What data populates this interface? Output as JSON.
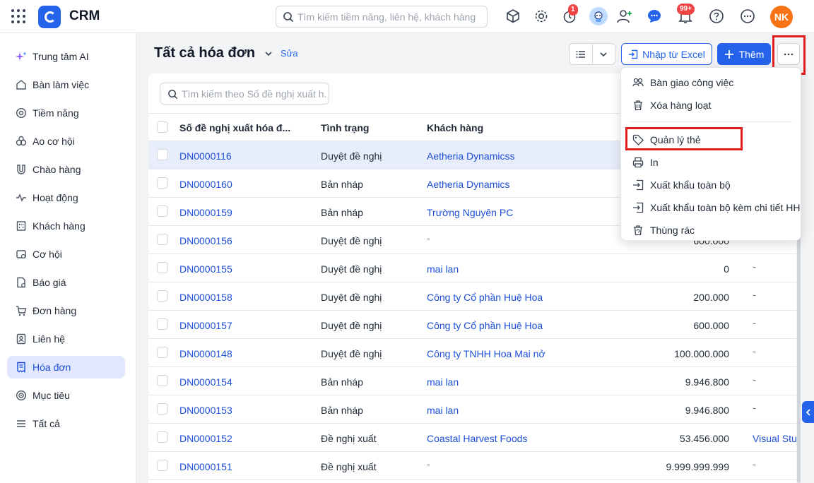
{
  "app": {
    "title": "CRM",
    "avatar_initials": "NK"
  },
  "header": {
    "search_placeholder": "Tìm kiếm tiềm năng, liên hệ, khách hàng",
    "timer_badge": "1",
    "notification_badge": "99+"
  },
  "sidebar": {
    "items": [
      {
        "label": "Trung tâm AI",
        "icon": "sparkle-icon"
      },
      {
        "label": "Bàn làm việc",
        "icon": "home-icon"
      },
      {
        "label": "Tiềm năng",
        "icon": "target-icon"
      },
      {
        "label": "Ao cơ hội",
        "icon": "people-icon"
      },
      {
        "label": "Chào hàng",
        "icon": "magnet-icon"
      },
      {
        "label": "Hoạt động",
        "icon": "activity-icon"
      },
      {
        "label": "Khách hàng",
        "icon": "building-icon"
      },
      {
        "label": "Cơ hội",
        "icon": "opportunity-icon"
      },
      {
        "label": "Báo giá",
        "icon": "quote-icon"
      },
      {
        "label": "Đơn hàng",
        "icon": "cart-icon"
      },
      {
        "label": "Liên hệ",
        "icon": "contact-icon"
      },
      {
        "label": "Hóa đơn",
        "icon": "invoice-icon",
        "active": true
      },
      {
        "label": "Mục tiêu",
        "icon": "goal-icon"
      },
      {
        "label": "Tất cả",
        "icon": "menu-icon"
      }
    ]
  },
  "page": {
    "title": "Tất cả hóa đơn",
    "edit_label": "Sửa",
    "import_label": "Nhập từ Excel",
    "add_label": "Thêm"
  },
  "table": {
    "search_placeholder": "Tìm kiếm theo Số đề nghị xuất h...",
    "columns": [
      "Số đề nghị xuất hóa đ...",
      "Tình trạng",
      "Khách hàng"
    ],
    "rows": [
      {
        "code": "DN0000116",
        "status": "Duyệt đề nghị",
        "customer": "Aetheria Dynamicss",
        "amount": "",
        "extra": ""
      },
      {
        "code": "DN0000160",
        "status": "Bản nháp",
        "customer": "Aetheria Dynamics",
        "amount": "",
        "extra": ""
      },
      {
        "code": "DN0000159",
        "status": "Bản nháp",
        "customer": "Trường Nguyên PC",
        "amount": "",
        "extra": ""
      },
      {
        "code": "DN0000156",
        "status": "Duyệt đề nghị",
        "customer": "-",
        "amount": "600.000",
        "extra": ""
      },
      {
        "code": "DN0000155",
        "status": "Duyệt đề nghị",
        "customer": "mai lan",
        "amount": "0",
        "extra": "-"
      },
      {
        "code": "DN0000158",
        "status": "Duyệt đề nghị",
        "customer": "Công ty Cổ phần Huệ Hoa",
        "amount": "200.000",
        "extra": "-"
      },
      {
        "code": "DN0000157",
        "status": "Duyệt đề nghị",
        "customer": "Công ty Cổ phần Huệ Hoa",
        "amount": "600.000",
        "extra": "-"
      },
      {
        "code": "DN0000148",
        "status": "Duyệt đề nghị",
        "customer": "Công ty TNHH Hoa Mai nở",
        "amount": "100.000.000",
        "extra": "-"
      },
      {
        "code": "DN0000154",
        "status": "Bản nháp",
        "customer": "mai lan",
        "amount": "9.946.800",
        "extra": "-"
      },
      {
        "code": "DN0000153",
        "status": "Bản nháp",
        "customer": "mai lan",
        "amount": "9.946.800",
        "extra": "-"
      },
      {
        "code": "DN0000152",
        "status": "Đề nghị xuất",
        "customer": "Coastal Harvest Foods",
        "amount": "53.456.000",
        "extra": "Visual Stu"
      },
      {
        "code": "DN0000151",
        "status": "Đề nghị xuất",
        "customer": "-",
        "amount": "9.999.999.999",
        "extra": "-"
      }
    ]
  },
  "more_menu": {
    "items": [
      {
        "label": "Bàn giao công việc",
        "icon": "handover-icon"
      },
      {
        "label": "Xóa hàng loạt",
        "icon": "trash-icon"
      },
      {
        "label": "Quản lý thẻ",
        "icon": "tag-icon"
      },
      {
        "label": "In",
        "icon": "printer-icon"
      },
      {
        "label": "Xuất khẩu toàn bộ",
        "icon": "export-icon"
      },
      {
        "label": "Xuất khẩu toàn bộ kèm chi tiết HH",
        "icon": "export-detail-icon"
      },
      {
        "label": "Thùng rác",
        "icon": "recycle-bin-icon"
      }
    ]
  },
  "colors": {
    "accent": "#2563eb",
    "highlight_box": "#e11d1d",
    "active_nav_bg": "#e0e7ff"
  }
}
